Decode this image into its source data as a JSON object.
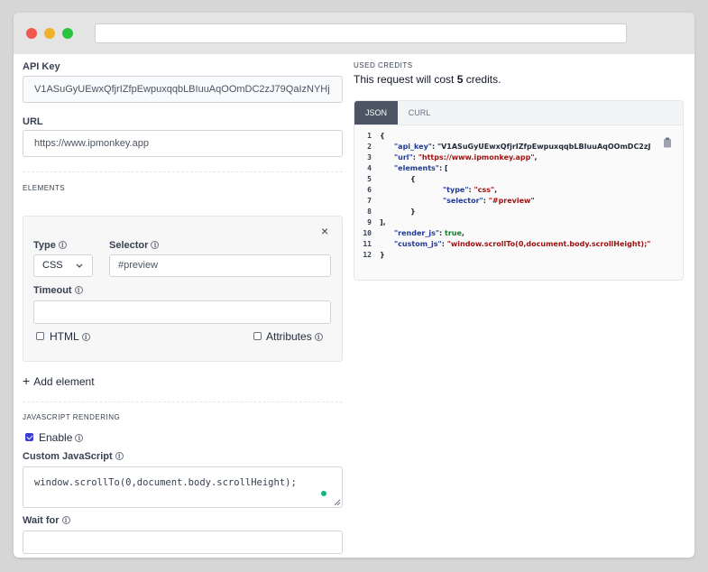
{
  "form": {
    "api_key_label": "API Key",
    "api_key_value": "V1ASuGyUEwxQfjrIZfpEwpuxqqbLBIuuAqOOmDC2zJ79QaIzNYHj",
    "url_label": "URL",
    "url_value": "https://www.ipmonkey.app",
    "elements_title": "ELEMENTS",
    "element": {
      "type_label": "Type",
      "type_value": "CSS",
      "selector_label": "Selector",
      "selector_value": "#preview",
      "timeout_label": "Timeout",
      "timeout_value": "",
      "html_label": "HTML",
      "attributes_label": "Attributes",
      "close_glyph": "×"
    },
    "add_element_label": "Add element",
    "add_glyph": "+",
    "js_title": "JAVASCRIPT RENDERING",
    "enable_label": "Enable",
    "enable_checked": true,
    "custom_js_label": "Custom JavaScript",
    "custom_js_value": "window.scrollTo(0,document.body.scrollHeight);",
    "wait_for_label": "Wait for",
    "wait_for_value": ""
  },
  "credits": {
    "title": "USED CREDITS",
    "text_before": "This request will cost ",
    "amount": "5",
    "text_after": " credits."
  },
  "code": {
    "tabs": [
      "JSON",
      "CURL"
    ],
    "active_tab": "JSON",
    "line_numbers": [
      "1",
      "2",
      "3",
      "4",
      "5",
      "6",
      "7",
      "8",
      "9",
      "10",
      "11",
      "12"
    ],
    "lines": [
      "{",
      "\"api_key\": \"V1ASuGyUEwxQfjrIZfpEwpuxqqbLBIuuAqOOmDC2zJ",
      "\"url\": \"https://www.ipmonkey.app\",",
      "\"elements\": [",
      "{",
      "\"type\": \"css\",",
      "\"selector\": \"#preview\"",
      "}",
      "],",
      "\"render_js\": true,",
      "\"custom_js\": \"window.scrollTo(0,document.body.scrollHeight);\"",
      "}"
    ]
  },
  "colors": {
    "accent": "#3b3bd6",
    "tab_active": "#4b5563",
    "json_key": "#1f3a93",
    "json_string": "#a01010",
    "json_bool": "#157a2a",
    "status_dot": "#10b981"
  },
  "icons": {
    "info": "info-circle-icon",
    "close": "close-icon",
    "add": "plus-icon",
    "copy": "clipboard-icon",
    "chevron": "chevron-down-icon"
  }
}
